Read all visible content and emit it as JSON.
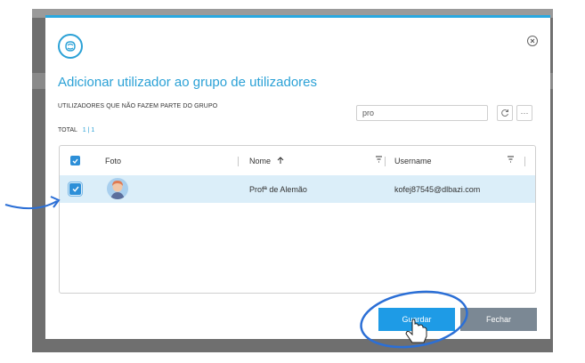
{
  "dialog": {
    "title": "Adicionar utilizador ao grupo de utilizadores",
    "subtitle": "UTILIZADORES QUE NÃO FAZEM PARTE DO GRUPO",
    "total_label": "TOTAL",
    "total_count": "1 | 1",
    "logo_icon": "brain-icon",
    "close_icon": "close-circle-icon"
  },
  "search": {
    "value": "pro"
  },
  "toolbar": {
    "refresh_icon": "refresh-icon",
    "more_label": "···"
  },
  "table": {
    "columns": {
      "photo": "Foto",
      "name": "Nome",
      "username": "Username"
    },
    "sort_icon": "arrow-up-icon",
    "filter_icon": "filter-icon",
    "rows": [
      {
        "selected": true,
        "name": "Profª de Alemão",
        "username": "kofej87545@dlbazi.com"
      }
    ]
  },
  "buttons": {
    "save": "Guardar",
    "close": "Fechar"
  },
  "colors": {
    "accent": "#2ba1d6",
    "save": "#1e9be6",
    "close": "#7b8894",
    "row_selected": "#dbeef9",
    "annotation": "#2b6fd6"
  }
}
